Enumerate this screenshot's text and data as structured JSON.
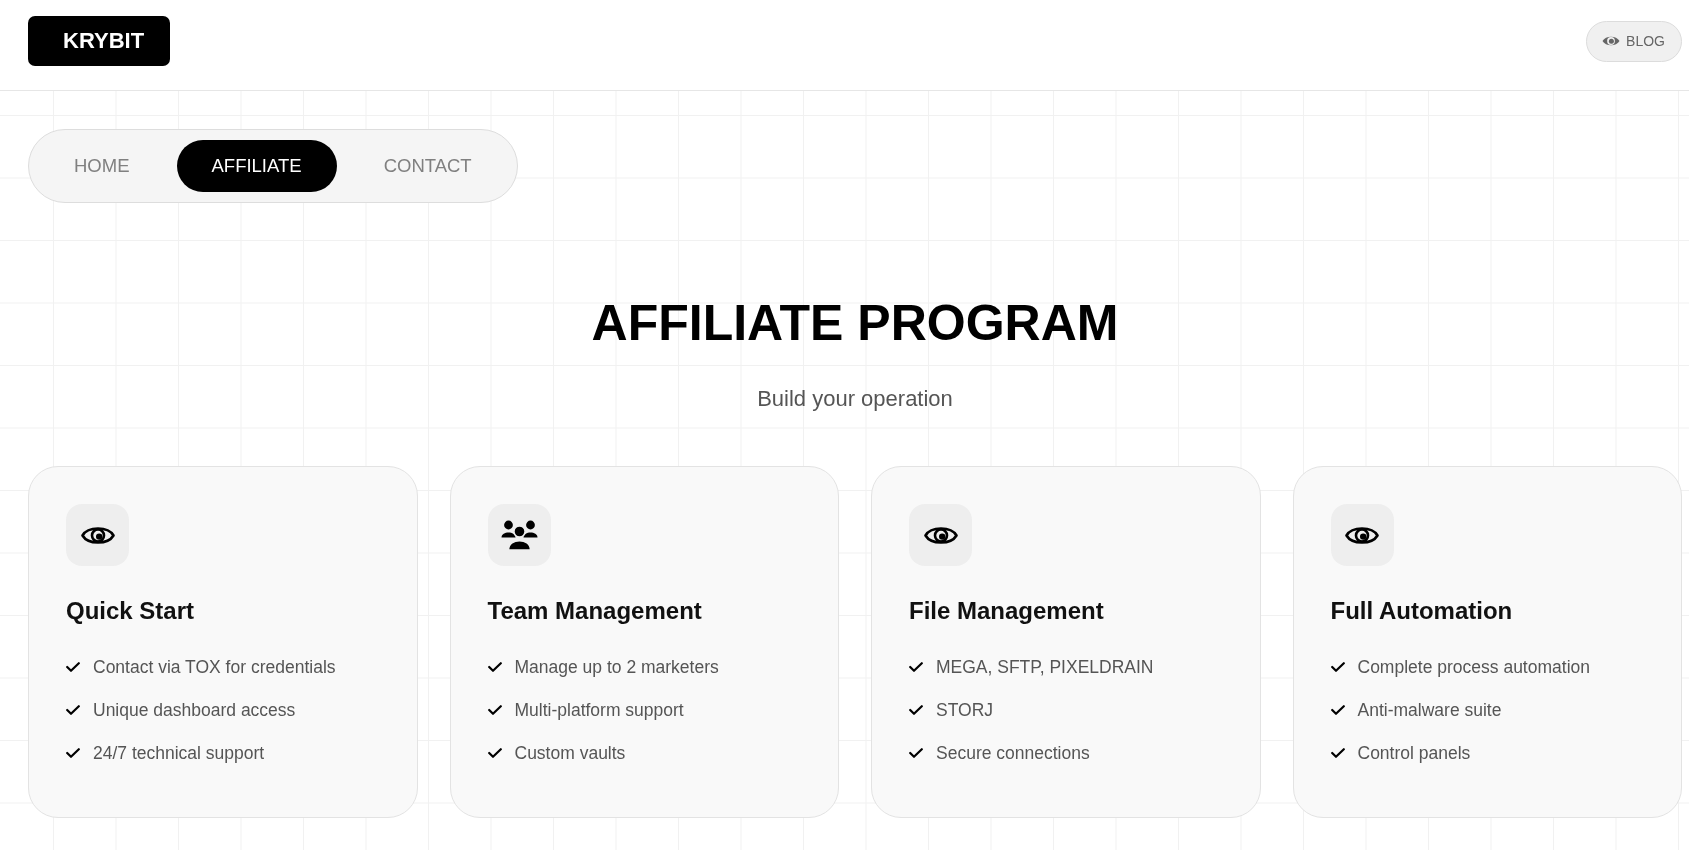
{
  "header": {
    "logo": "KRYBIT",
    "blog_button": "BLOG"
  },
  "nav": {
    "items": [
      {
        "label": "HOME",
        "selected": false
      },
      {
        "label": "AFFILIATE",
        "selected": true
      },
      {
        "label": "CONTACT",
        "selected": false
      }
    ]
  },
  "hero": {
    "title": "AFFILIATE PROGRAM",
    "subtitle": "Build your operation"
  },
  "cards": [
    {
      "kind": "eye",
      "title": "Quick Start",
      "features": [
        "Contact via TOX for credentials",
        "Unique dashboard access",
        "24/7 technical support"
      ]
    },
    {
      "kind": "team",
      "title": "Team Management",
      "features": [
        "Manage up to 2 marketers",
        "Multi-platform support",
        "Custom vaults"
      ]
    },
    {
      "kind": "eye",
      "title": "File Management",
      "features": [
        "MEGA, SFTP, PIXELDRAIN",
        "STORJ",
        "Secure connections"
      ]
    },
    {
      "kind": "eye",
      "title": "Full Automation",
      "features": [
        "Complete process automation",
        "Anti-malware suite",
        "Control panels"
      ]
    }
  ]
}
